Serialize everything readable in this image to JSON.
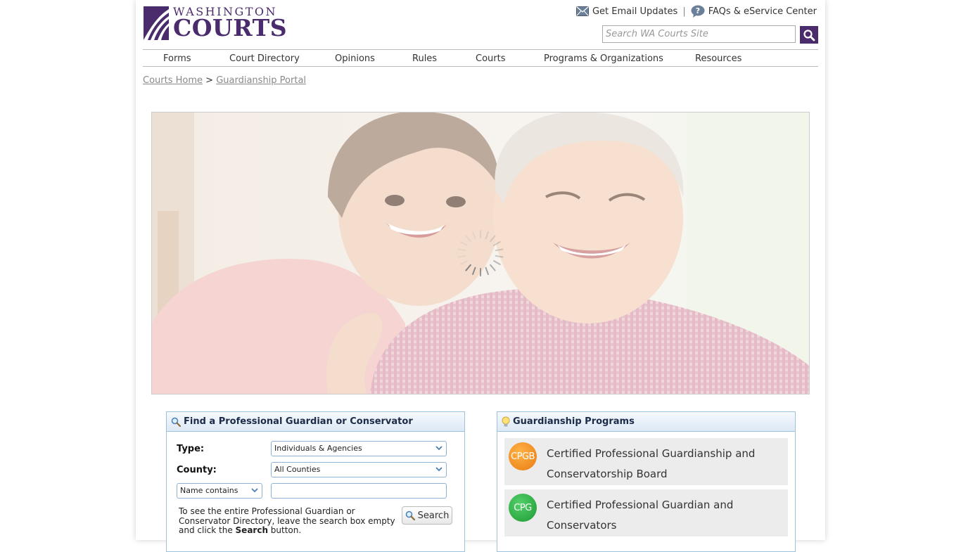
{
  "header": {
    "logo_top": "WASHINGTON",
    "logo_bottom": "COURTS",
    "email_link": "Get Email Updates",
    "separator": "|",
    "faq_link": "FAQs & eService Center",
    "search_placeholder": "Search WA Courts Site"
  },
  "nav": {
    "items": [
      "Forms",
      "Court Directory",
      "Opinions",
      "Rules",
      "Courts",
      "Programs & Organizations",
      "Resources"
    ]
  },
  "breadcrumb": {
    "home": "Courts Home",
    "separator": ">",
    "current": "Guardianship Portal"
  },
  "find_panel": {
    "title": "Find a Professional Guardian or Conservator",
    "type_label": "Type:",
    "type_value": "Individuals & Agencies",
    "county_label": "County:",
    "county_value": "All Counties",
    "name_filter": "Name contains",
    "note_pre": "To see the entire Professional Guardian or Conservator Directory, leave the search box empty and click the ",
    "note_bold": "Search",
    "note_post": " button.",
    "search_button": "Search"
  },
  "programs_panel": {
    "title": "Guardianship Programs",
    "items": [
      {
        "badge": "CPGB",
        "label": "Certified Professional Guardianship and Conservatorship Board",
        "color": "#f08c1e"
      },
      {
        "badge": "CPG",
        "label": "Certified Professional Guardian and Conservators",
        "color": "#2eaa3e"
      }
    ]
  },
  "colors": {
    "brand": "#4a2b6b",
    "panel_border": "#9cc3dd"
  }
}
